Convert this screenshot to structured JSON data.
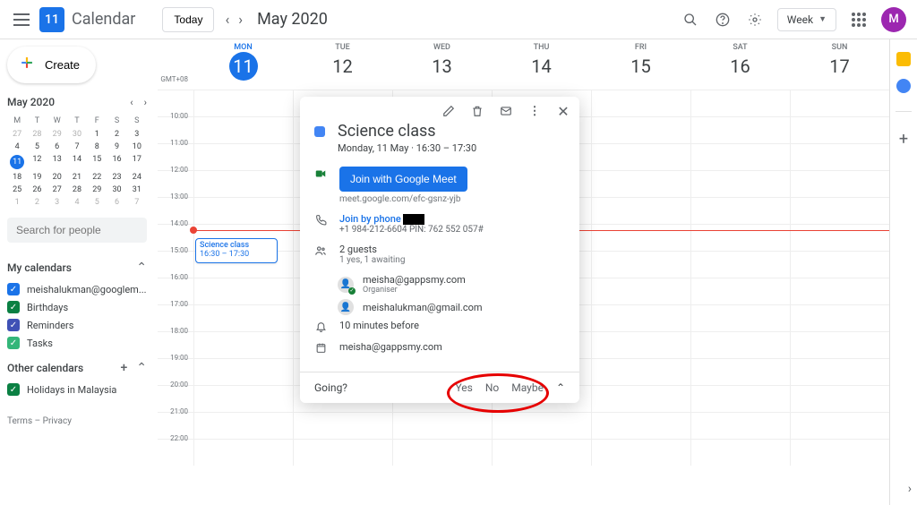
{
  "header": {
    "logo_date": "11",
    "logo_text": "Calendar",
    "today": "Today",
    "month": "May 2020",
    "view": "Week",
    "avatar": "M"
  },
  "sidebar": {
    "create": "Create",
    "mini_month": "May 2020",
    "weekdays": [
      "M",
      "T",
      "W",
      "T",
      "F",
      "S",
      "S"
    ],
    "weeks": [
      [
        {
          "d": "27",
          "o": true
        },
        {
          "d": "28",
          "o": true
        },
        {
          "d": "29",
          "o": true
        },
        {
          "d": "30",
          "o": true
        },
        {
          "d": "1"
        },
        {
          "d": "2"
        },
        {
          "d": "3"
        }
      ],
      [
        {
          "d": "4"
        },
        {
          "d": "5"
        },
        {
          "d": "6"
        },
        {
          "d": "7"
        },
        {
          "d": "8"
        },
        {
          "d": "9"
        },
        {
          "d": "10"
        }
      ],
      [
        {
          "d": "11",
          "sel": true
        },
        {
          "d": "12"
        },
        {
          "d": "13"
        },
        {
          "d": "14"
        },
        {
          "d": "15"
        },
        {
          "d": "16"
        },
        {
          "d": "17"
        }
      ],
      [
        {
          "d": "18"
        },
        {
          "d": "19"
        },
        {
          "d": "20"
        },
        {
          "d": "21"
        },
        {
          "d": "22"
        },
        {
          "d": "23"
        },
        {
          "d": "24"
        }
      ],
      [
        {
          "d": "25"
        },
        {
          "d": "26"
        },
        {
          "d": "27"
        },
        {
          "d": "28"
        },
        {
          "d": "29"
        },
        {
          "d": "30"
        },
        {
          "d": "31"
        }
      ],
      [
        {
          "d": "1",
          "o": true
        },
        {
          "d": "2",
          "o": true
        },
        {
          "d": "3",
          "o": true
        },
        {
          "d": "4",
          "o": true
        },
        {
          "d": "5",
          "o": true
        },
        {
          "d": "6",
          "o": true
        },
        {
          "d": "7",
          "o": true
        }
      ]
    ],
    "search_placeholder": "Search for people",
    "my_cal_title": "My calendars",
    "my_cals": [
      {
        "label": "meishalukman@googlem...",
        "color": "#1a73e8"
      },
      {
        "label": "Birthdays",
        "color": "#0b8043"
      },
      {
        "label": "Reminders",
        "color": "#3f51b5"
      },
      {
        "label": "Tasks",
        "color": "#33b679"
      }
    ],
    "other_cal_title": "Other calendars",
    "other_cals": [
      {
        "label": "Holidays in Malaysia",
        "color": "#0b8043"
      }
    ],
    "terms": "Terms",
    "privacy": "Privacy"
  },
  "grid": {
    "tz": "GMT+08",
    "days": [
      {
        "name": "MON",
        "num": "11",
        "today": true
      },
      {
        "name": "TUE",
        "num": "12"
      },
      {
        "name": "WED",
        "num": "13"
      },
      {
        "name": "THU",
        "num": "14"
      },
      {
        "name": "FRI",
        "num": "15"
      },
      {
        "name": "SAT",
        "num": "16"
      },
      {
        "name": "SUN",
        "num": "17"
      }
    ],
    "hours": [
      "",
      "10:00",
      "11:00",
      "12:00",
      "13:00",
      "14:00",
      "15:00",
      "16:00",
      "17:00",
      "18:00",
      "19:00",
      "20:00",
      "21:00",
      "22:00"
    ],
    "event": {
      "title": "Science class",
      "time": "16:30 – 17:30"
    }
  },
  "popup": {
    "title": "Science class",
    "subtitle": "Monday, 11 May  ·  16:30 – 17:30",
    "meet_btn": "Join with Google Meet",
    "meet_link": "meet.google.com/efc-gsnz-yjb",
    "phone_label": "Join by phone",
    "phone_detail": "+1 984-212-6604 PIN: 762 552 057#",
    "guests_label": "2 guests",
    "guests_sub": "1 yes, 1 awaiting",
    "guest1_email": "meisha@gappsmy.com",
    "guest1_role": "Organiser",
    "guest2_email": "meishalukman@gmail.com",
    "reminder": "10 minutes before",
    "calendar": "meisha@gappsmy.com",
    "going_label": "Going?",
    "yes": "Yes",
    "no": "No",
    "maybe": "Maybe"
  }
}
